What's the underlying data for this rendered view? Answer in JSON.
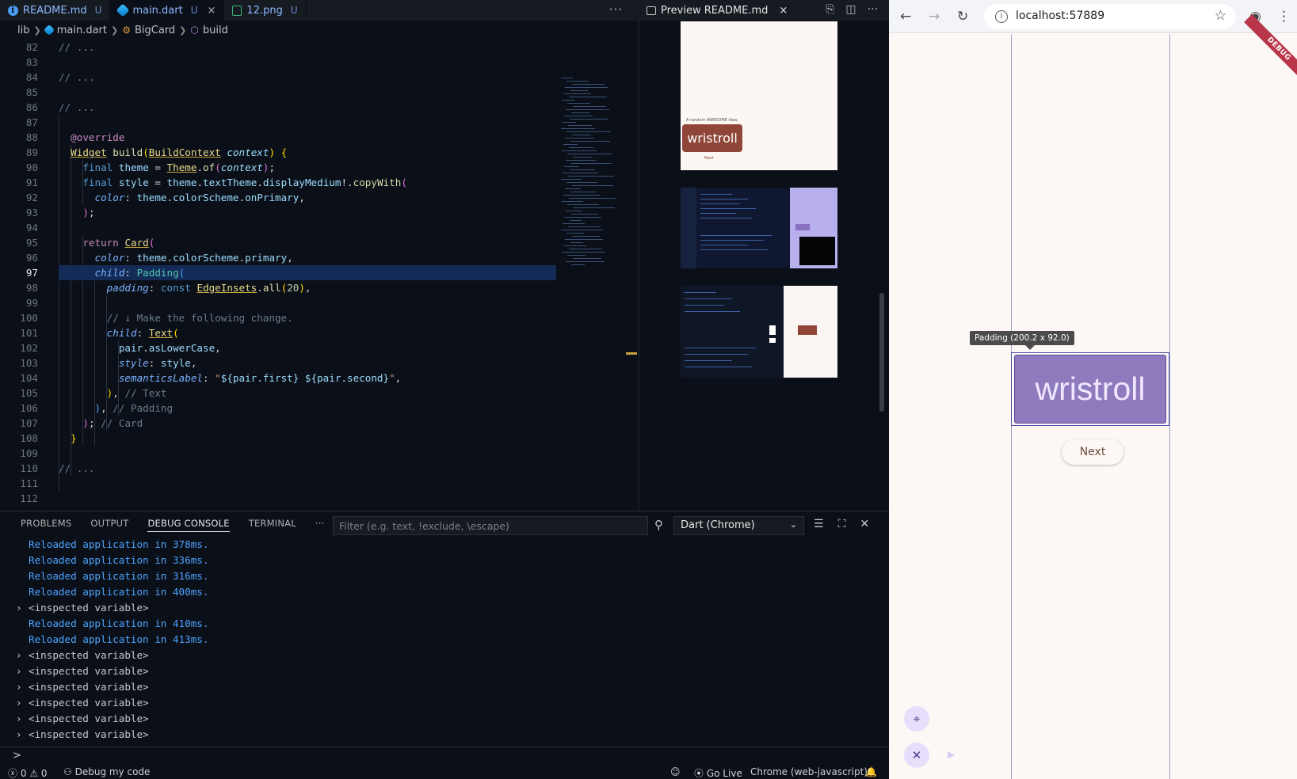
{
  "vscode": {
    "tabs": [
      {
        "label": "README.md",
        "status": "U",
        "icon": "info-icon"
      },
      {
        "label": "main.dart",
        "status": "U",
        "icon": "dart-icon",
        "close": "×"
      },
      {
        "label": "12.png",
        "status": "U",
        "icon": "image-icon"
      }
    ],
    "tab_more": "···",
    "breadcrumb": [
      "lib",
      "main.dart",
      "BigCard",
      "build"
    ],
    "line_numbers": [
      "82",
      "83",
      "84",
      "85",
      "86",
      "87",
      "88",
      "89",
      "90",
      "91",
      "92",
      "93",
      "94",
      "95",
      "96",
      "97",
      "98",
      "99",
      "100",
      "101",
      "102",
      "103",
      "104",
      "105",
      "106",
      "107",
      "108",
      "109",
      "110",
      "111",
      "112"
    ],
    "current_line": "97",
    "preview": {
      "title": "Preview README.md",
      "close": "×",
      "thumb1_idea": "A random AWESOME idea:",
      "thumb1_word": "wristroll",
      "thumb1_next": "Next"
    },
    "panel": {
      "tabs": [
        "PROBLEMS",
        "OUTPUT",
        "DEBUG CONSOLE",
        "TERMINAL"
      ],
      "more": "···",
      "filter_placeholder": "Filter (e.g. text, !exclude, \\escape)",
      "session": "Dart (Chrome)",
      "console": [
        {
          "type": "msg",
          "text": "Reloaded application in 378ms."
        },
        {
          "type": "msg",
          "text": "Reloaded application in 336ms."
        },
        {
          "type": "msg",
          "text": "Reloaded application in 316ms."
        },
        {
          "type": "msg",
          "text": "Reloaded application in 400ms."
        },
        {
          "type": "var",
          "text": "<inspected variable>"
        },
        {
          "type": "msg",
          "text": "Reloaded application in 410ms."
        },
        {
          "type": "msg",
          "text": "Reloaded application in 413ms."
        },
        {
          "type": "var",
          "text": "<inspected variable>"
        },
        {
          "type": "var",
          "text": "<inspected variable>"
        },
        {
          "type": "var",
          "text": "<inspected variable>"
        },
        {
          "type": "var",
          "text": "<inspected variable>"
        },
        {
          "type": "var",
          "text": "<inspected variable>"
        },
        {
          "type": "var",
          "text": "<inspected variable>"
        }
      ],
      "prompt": ">"
    },
    "status": {
      "errors": "0",
      "warnings": "0",
      "debug": "Debug my code",
      "go_live": "Go Live",
      "target": "Chrome (web-javascript)"
    }
  },
  "browser": {
    "url": "localhost:57889",
    "debug_banner": "DEBUG",
    "tooltip": "Padding (200.2 x 92.0)",
    "card_word": "wristroll",
    "next_label": "Next"
  },
  "colors": {
    "card_bg": "#8e7bbd",
    "page_bg": "#fdf7f5",
    "console_msg": "#4da3ff",
    "highlight_line": "#142b57"
  }
}
